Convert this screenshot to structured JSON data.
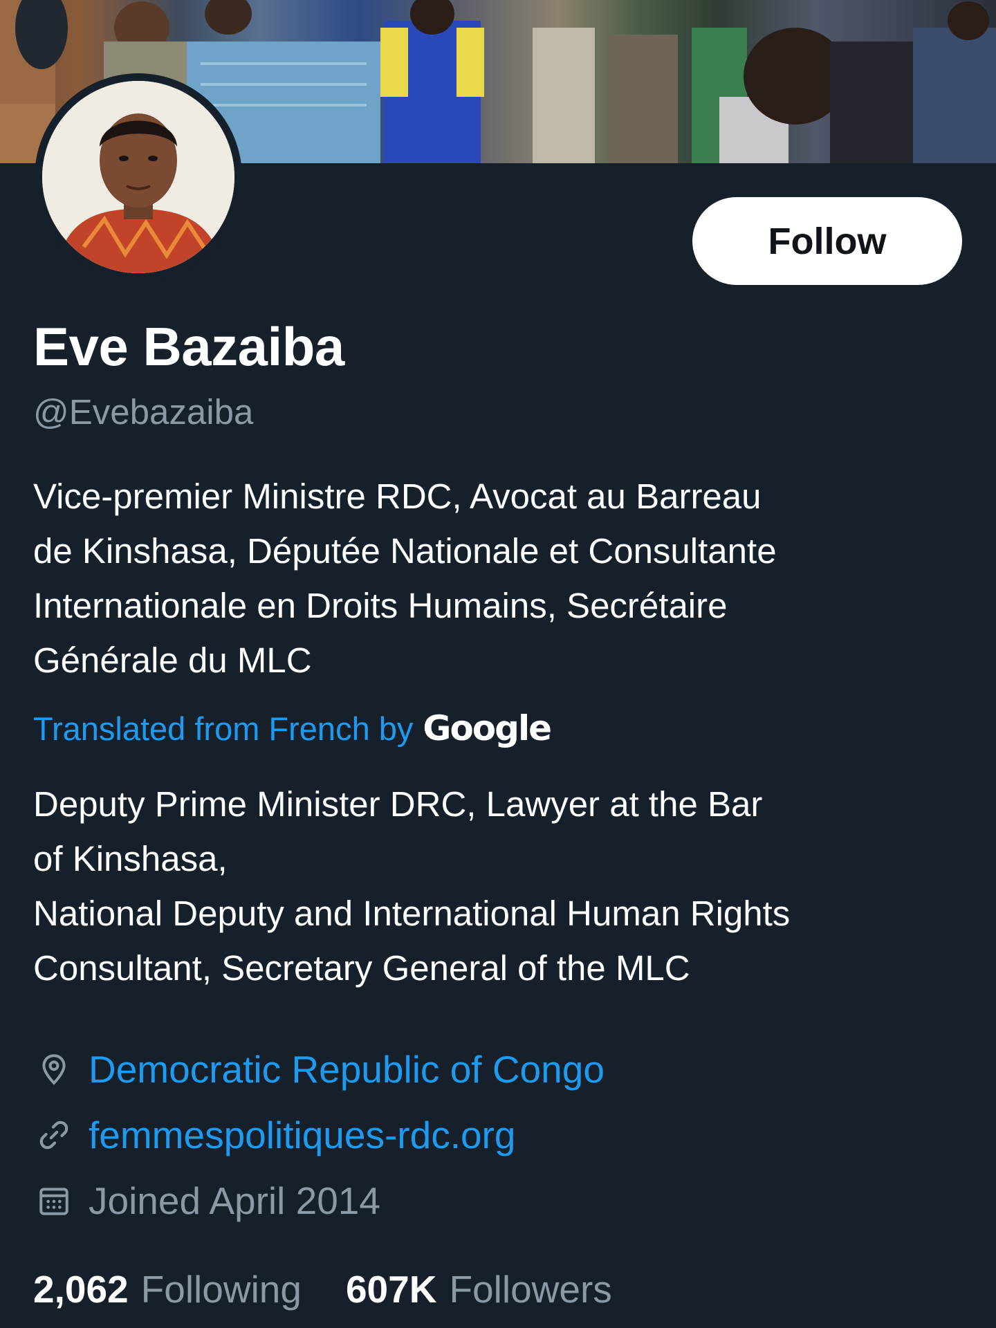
{
  "profile": {
    "name": "Eve Bazaiba",
    "handle": "@Evebazaiba",
    "follow_label": "Follow",
    "bio": "Vice-premier Ministre RDC, Avocat au Barreau\nde Kinshasa, Députée  Nationale et Consultante\nInternationale en Droits Humains, Secrétaire\nGénérale du MLC",
    "translated_by": "Translated from French by",
    "translator_logo_text": "Google",
    "bio_translated": "Deputy Prime Minister DRC, Lawyer at the Bar\nof Kinshasa,\nNational Deputy and International Human Rights\nConsultant, Secretary General of the MLC"
  },
  "meta": {
    "location": "Democratic Republic of Congo",
    "website": "femmespolitiques-rdc.org",
    "joined": "Joined April 2014"
  },
  "stats": {
    "following_count": "2,062",
    "following_label": "Following",
    "followers_count": "607K",
    "followers_label": "Followers"
  },
  "colors": {
    "background": "#15202b",
    "accent": "#1d9bf0",
    "secondary_text": "#8b98a5",
    "primary_text": "#ffffff"
  },
  "icons": {
    "location": "location-pin-icon",
    "website": "link-icon",
    "joined": "calendar-icon"
  }
}
